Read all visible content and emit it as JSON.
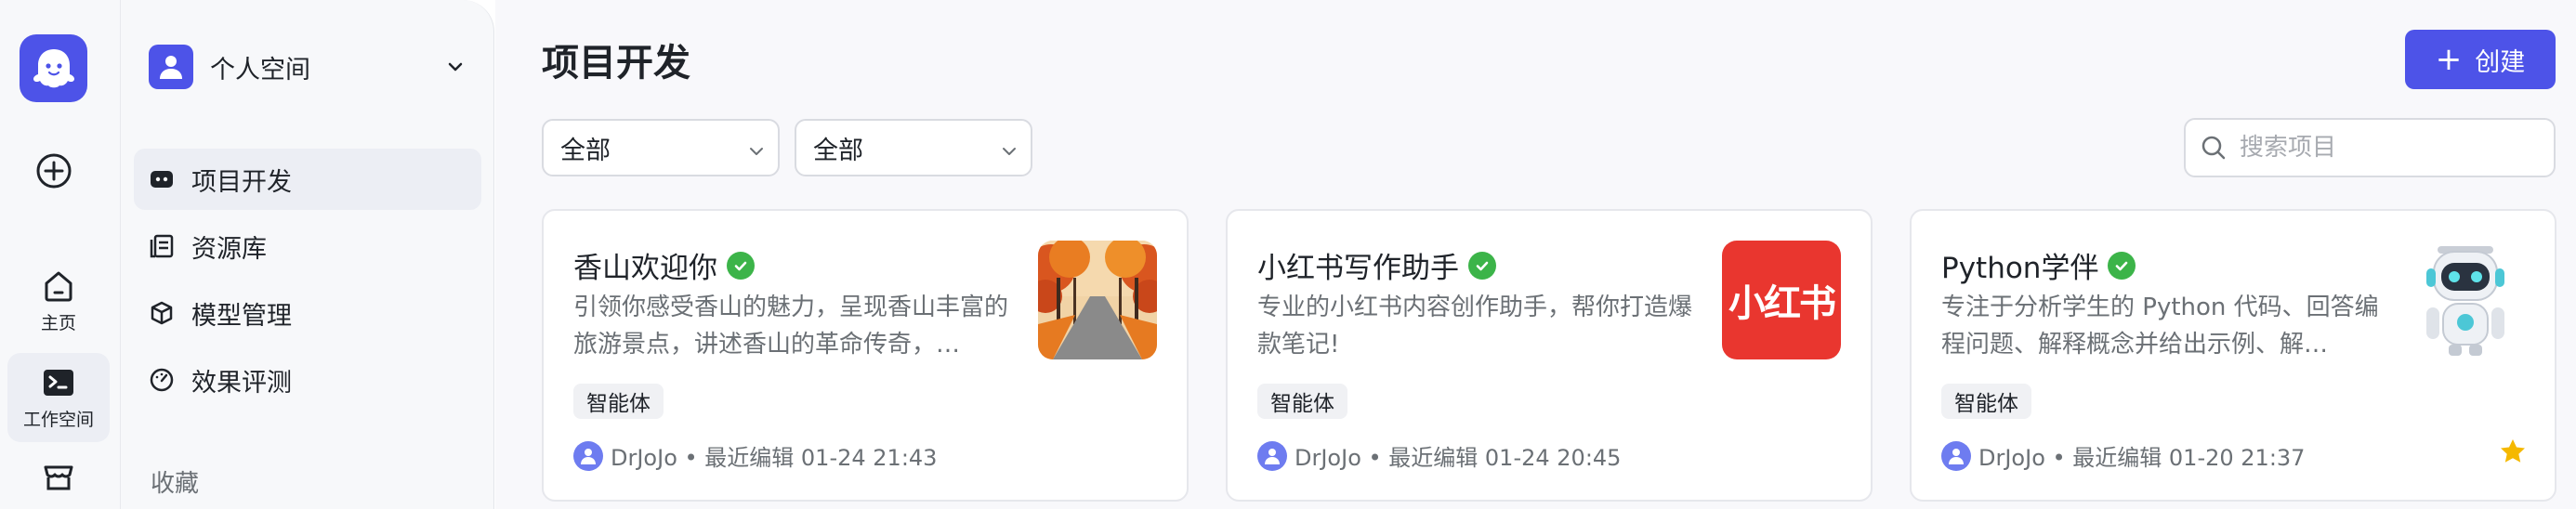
{
  "rail": {
    "items": [
      {
        "label": "主页",
        "icon": "home-icon"
      },
      {
        "label": "工作空间",
        "icon": "terminal-icon"
      },
      {
        "label": "",
        "icon": "store-icon"
      }
    ]
  },
  "sidebar": {
    "space_name": "个人空间",
    "nav": [
      {
        "label": "项目开发",
        "icon": "bot-icon"
      },
      {
        "label": "资源库",
        "icon": "library-icon"
      },
      {
        "label": "模型管理",
        "icon": "cube-icon"
      },
      {
        "label": "效果评测",
        "icon": "gauge-icon"
      }
    ],
    "section_title": "收藏"
  },
  "main": {
    "title": "项目开发",
    "create_label": "创建",
    "filter1": "全部",
    "filter2": "全部",
    "search_placeholder": "搜索项目",
    "cards": [
      {
        "name": "香山欢迎你",
        "desc": "引领你感受香山的魅力，呈现香山丰富的旅游景点，讲述香山的革命传奇，…",
        "tag": "智能体",
        "meta": "DrJoJo • 最近编辑 01-24 21:43",
        "thumb": "autumn-path-image"
      },
      {
        "name": "小红书写作助手",
        "desc": "专业的小红书内容创作助手，帮你打造爆款笔记!",
        "tag": "智能体",
        "meta": "DrJoJo • 最近编辑 01-24 20:45",
        "thumb_text": "小红书"
      },
      {
        "name": "Python学伴",
        "desc": "专注于分析学生的 Python 代码、回答编程问题、解释概念并给出示例、解…",
        "tag": "智能体",
        "meta": "DrJoJo • 最近编辑 01-20 21:37",
        "thumb": "robot-image",
        "favorite": true
      }
    ]
  },
  "colors": {
    "accent": "#4d53e8",
    "verified": "#3cb449",
    "xhs_red": "#e9362f",
    "star": "#f5b800"
  }
}
